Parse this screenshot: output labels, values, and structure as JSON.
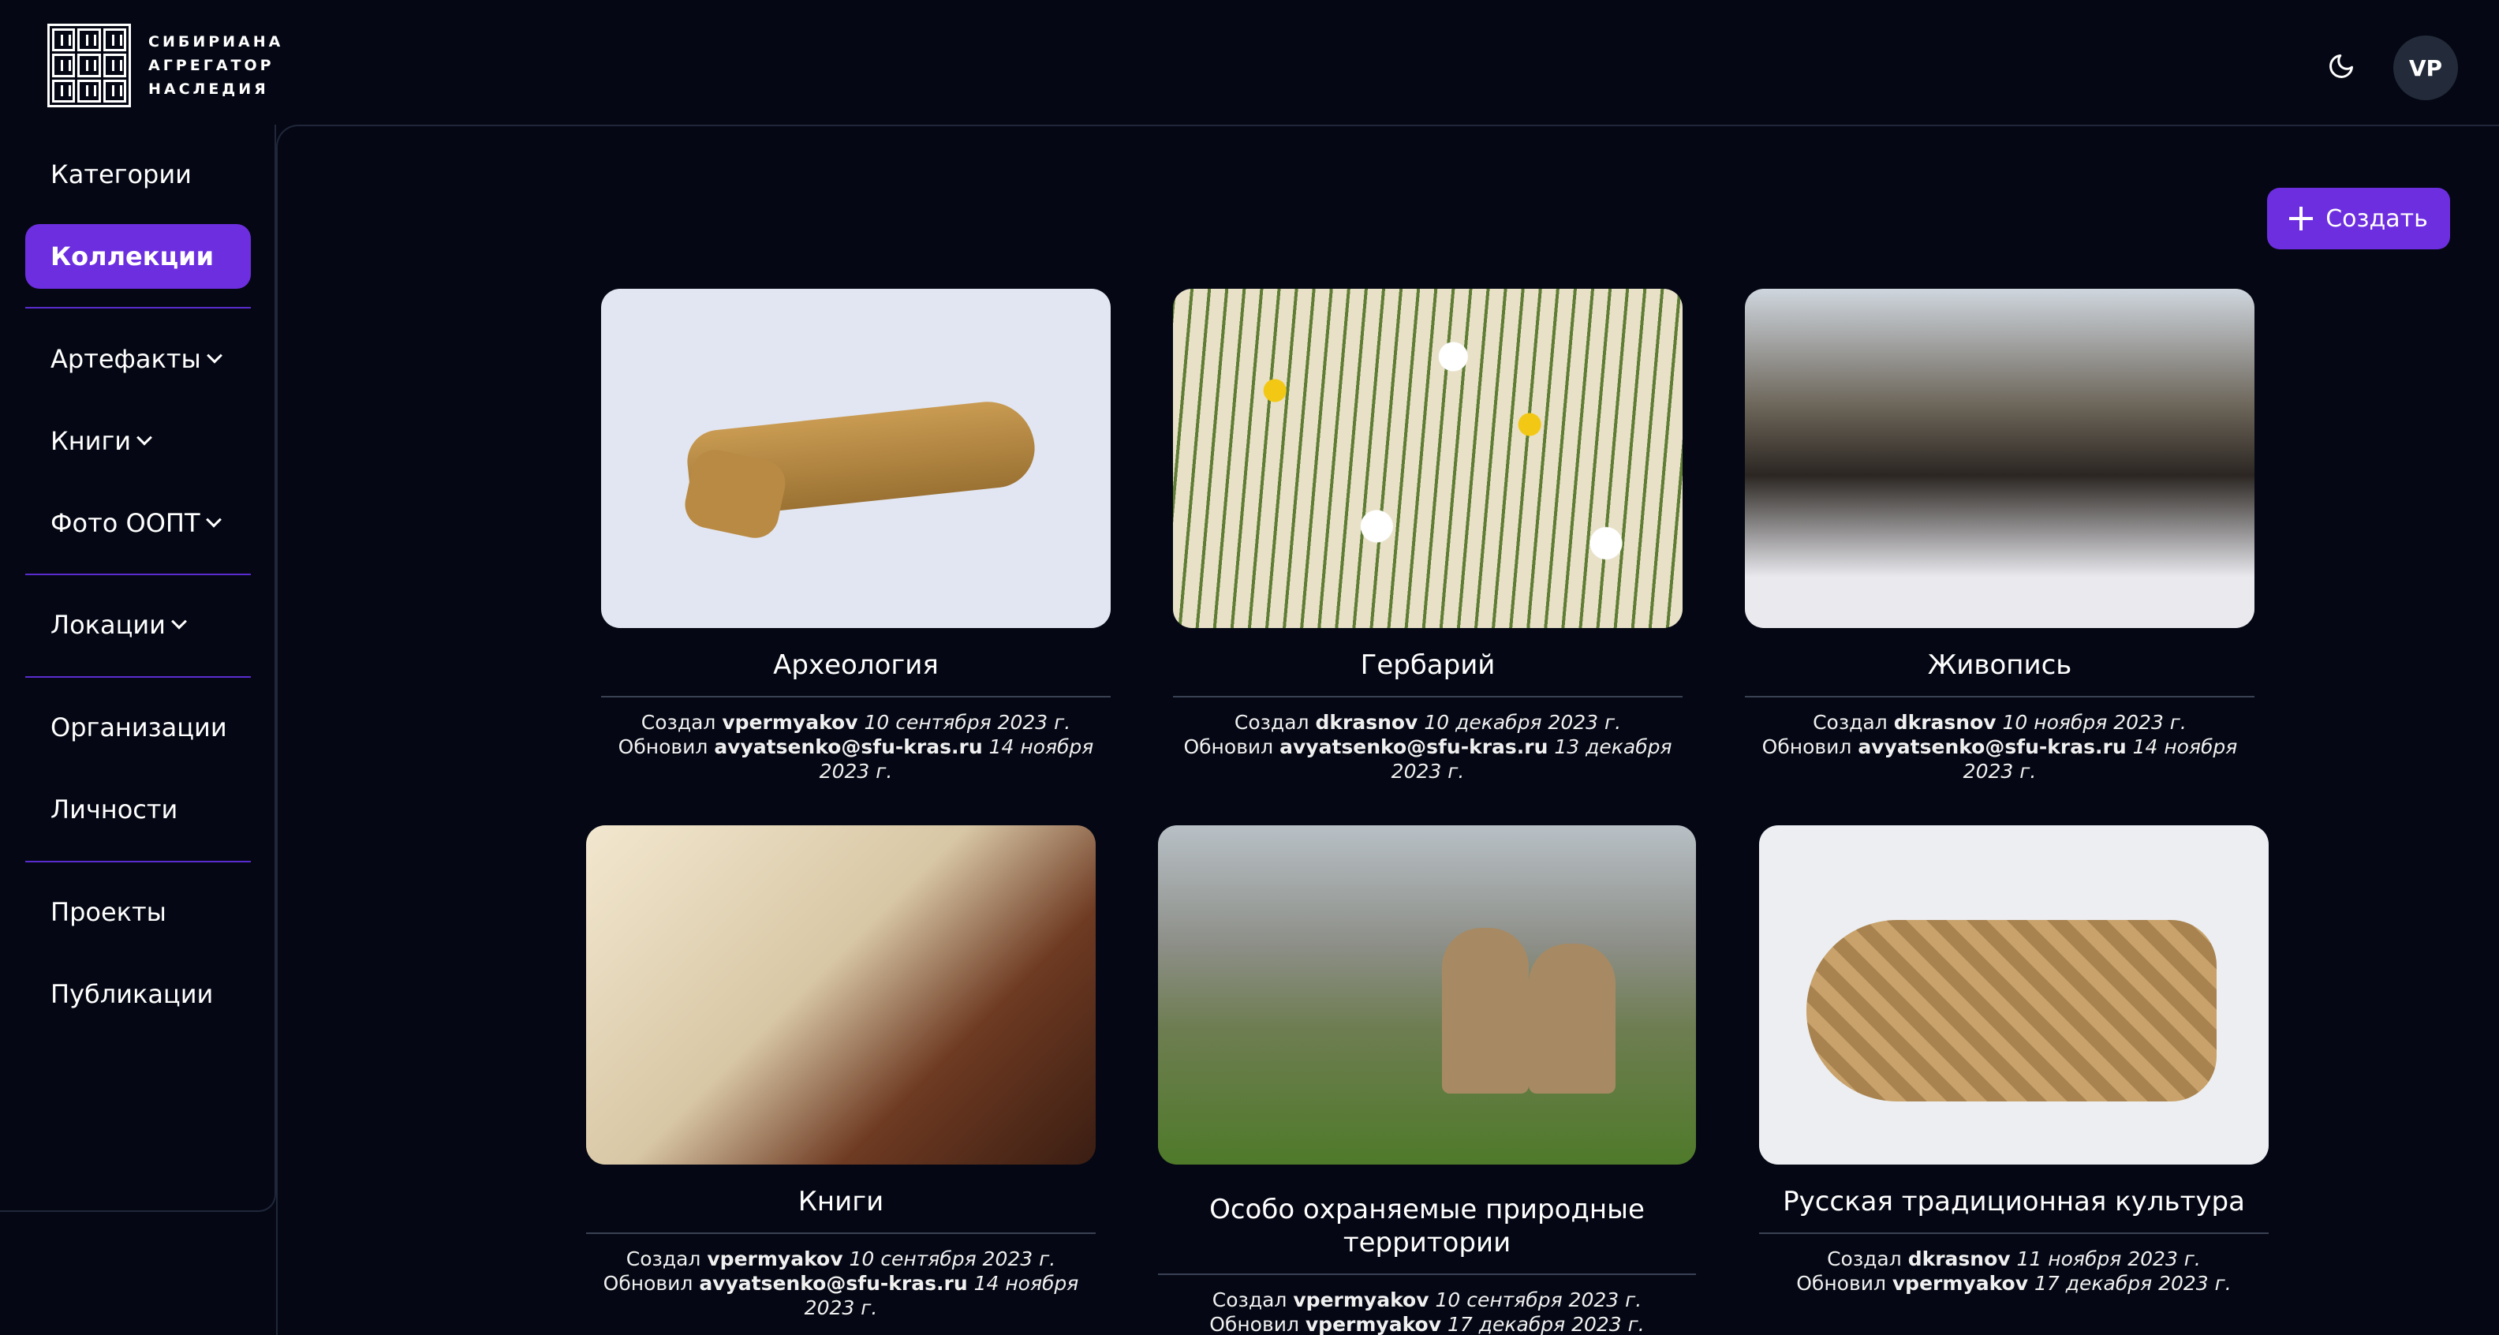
{
  "app": {
    "logo_lines": [
      "СИБИРИАНА",
      "АГРЕГАТОР",
      "НАСЛЕДИЯ"
    ],
    "avatar_initials": "VP",
    "accent_color": "#6d2ee0",
    "background_color": "#050814"
  },
  "sidebar": {
    "items": [
      {
        "label": "Категории",
        "dropdown": false,
        "active": false
      },
      {
        "label": "Коллекции",
        "dropdown": false,
        "active": true
      },
      {
        "label": "Артефакты",
        "dropdown": true,
        "active": false
      },
      {
        "label": "Книги",
        "dropdown": true,
        "active": false
      },
      {
        "label": "Фото ООПТ",
        "dropdown": true,
        "active": false
      },
      {
        "label": "Локации",
        "dropdown": true,
        "active": false
      },
      {
        "label": "Организации",
        "dropdown": false,
        "active": false
      },
      {
        "label": "Личности",
        "dropdown": false,
        "active": false
      },
      {
        "label": "Проекты",
        "dropdown": false,
        "active": false
      },
      {
        "label": "Публикации",
        "dropdown": false,
        "active": false
      }
    ]
  },
  "toolbar": {
    "create_label": "Создать"
  },
  "meta_labels": {
    "created": "Создал",
    "updated": "Обновил"
  },
  "cards": [
    {
      "title": "Археология",
      "created_by": "vpermyakov",
      "created_date": "10 сентября 2023 г.",
      "updated_by": "avyatsenko@sfu-kras.ru",
      "updated_date": "14 ноября 2023 г."
    },
    {
      "title": "Гербарий",
      "created_by": "dkrasnov",
      "created_date": "10 декабря 2023 г.",
      "updated_by": "avyatsenko@sfu-kras.ru",
      "updated_date": "13 декабря 2023 г."
    },
    {
      "title": "Живопись",
      "created_by": "dkrasnov",
      "created_date": "10 ноября 2023 г.",
      "updated_by": "avyatsenko@sfu-kras.ru",
      "updated_date": "14 ноября 2023 г."
    },
    {
      "title": "Книги",
      "created_by": "vpermyakov",
      "created_date": "10 сентября 2023 г.",
      "updated_by": "avyatsenko@sfu-kras.ru",
      "updated_date": "14 ноября 2023 г."
    },
    {
      "title": "Особо охраняемые природные территории",
      "created_by": "vpermyakov",
      "created_date": "10 сентября 2023 г.",
      "updated_by": "vpermyakov",
      "updated_date": "17 декабря 2023 г."
    },
    {
      "title": "Русская традиционная культура",
      "created_by": "dkrasnov",
      "created_date": "11 ноября 2023 г.",
      "updated_by": "vpermyakov",
      "updated_date": "17 декабря 2023 г."
    }
  ]
}
